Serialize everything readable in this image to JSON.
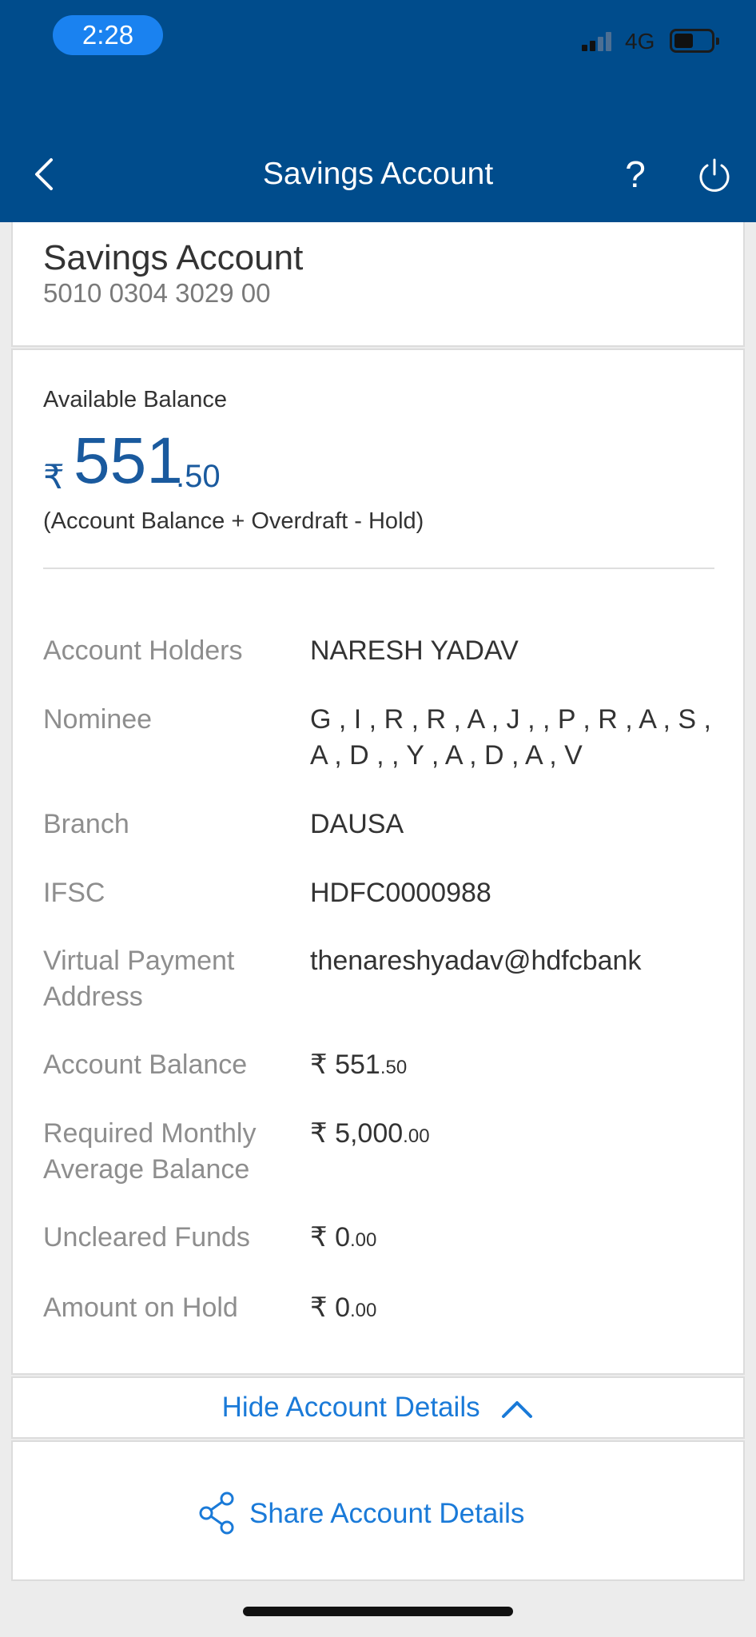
{
  "status_bar": {
    "time": "2:28",
    "network": "4G"
  },
  "header": {
    "title": "Savings Account"
  },
  "account": {
    "name": "Savings Account",
    "number": "5010 0304 3029 00"
  },
  "balance": {
    "label": "Available Balance",
    "currency_symbol": "₹",
    "integer": "551",
    "decimal": ".50",
    "formula": "(Account Balance + Overdraft - Hold)"
  },
  "details": [
    {
      "label": "Account Holders",
      "value": "NARESH YADAV"
    },
    {
      "label": "Nominee",
      "value": "G , I , R , R , A , J , , P , R , A , S , A , D , , Y , A , D , A , V"
    },
    {
      "label": "Branch",
      "value": "DAUSA"
    },
    {
      "label": "IFSC",
      "value": "HDFC0000988"
    },
    {
      "label": "Virtual Payment Address",
      "value": "thenareshyadav@hdfcbank"
    },
    {
      "label": "Account Balance",
      "value_main": "₹ 551",
      "value_small": ".50"
    },
    {
      "label": "Required Monthly Average Balance",
      "value_main": "₹ 5,000",
      "value_small": ".00"
    },
    {
      "label": "Uncleared Funds",
      "value_main": "₹ 0",
      "value_small": ".00"
    },
    {
      "label": "Amount on Hold",
      "value_main": "₹ 0",
      "value_small": ".00"
    }
  ],
  "actions": {
    "hide_details": "Hide Account Details",
    "share_details": "Share Account Details"
  },
  "colors": {
    "header_bg": "#004c8c",
    "balance_blue": "#1a5a9e",
    "link_blue": "#1a7ad8"
  },
  "icons": {
    "back": "chevron-left-icon",
    "help": "question-mark-icon",
    "power": "power-icon",
    "collapse": "chevron-up-icon",
    "share": "share-icon"
  }
}
